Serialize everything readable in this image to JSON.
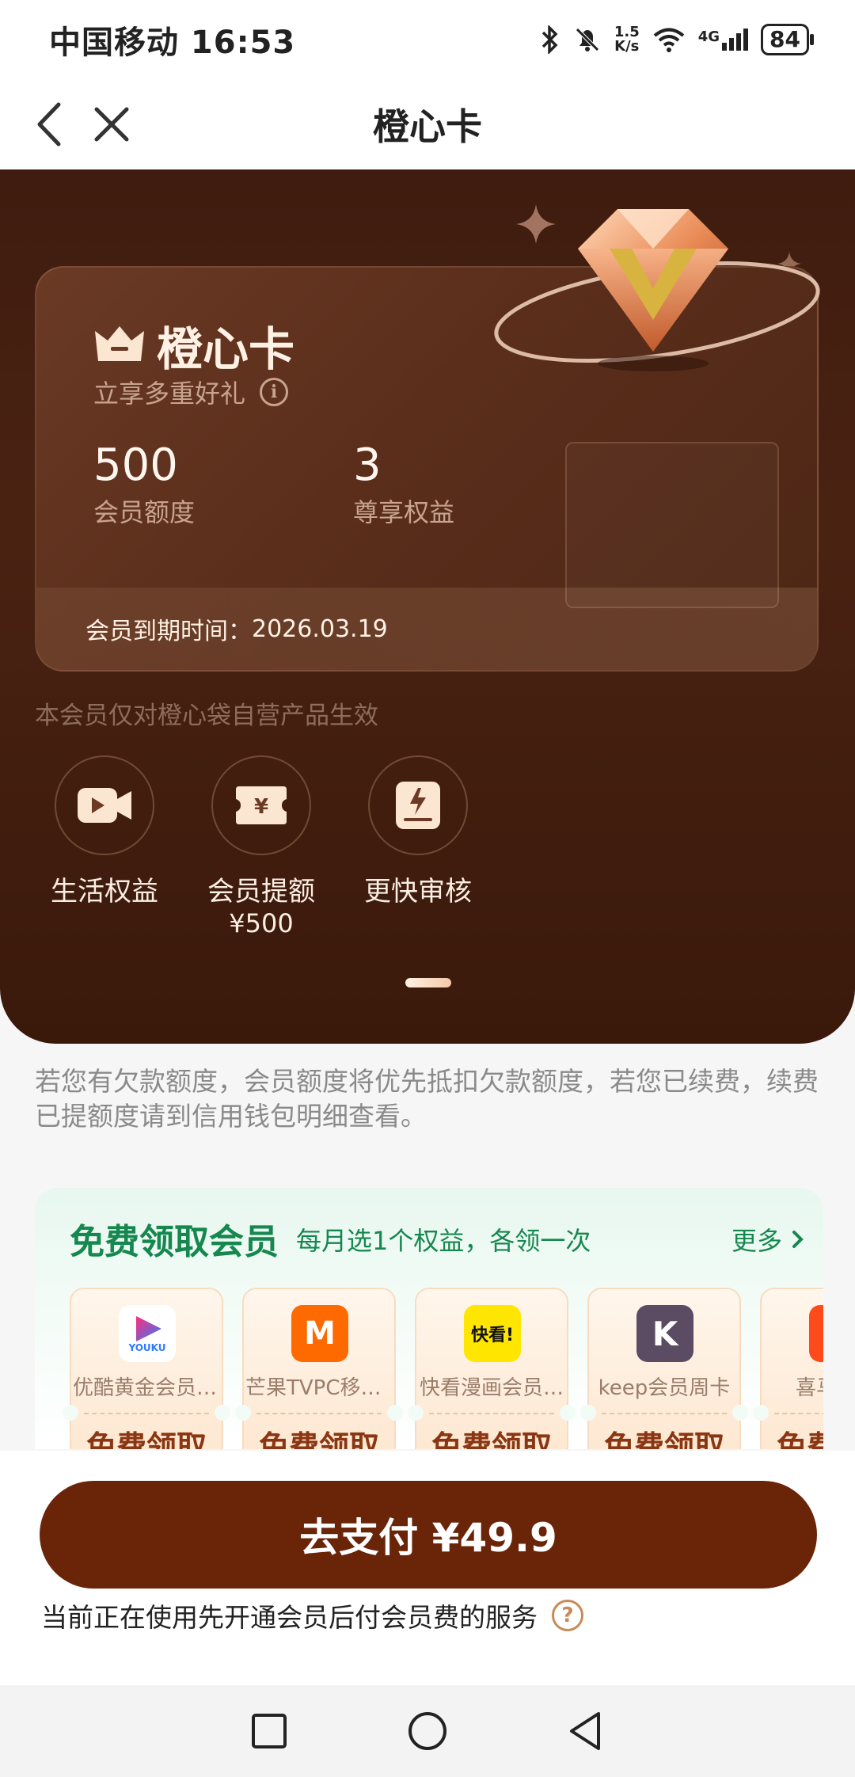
{
  "status_bar": {
    "carrier_time": "中国移动 16:53",
    "net_speed_top": "1.5",
    "net_speed_bottom": "K/s",
    "signal": "4G",
    "battery": "84"
  },
  "nav": {
    "title": "橙心卡",
    "back_icon": "chevron-left-icon",
    "close_icon": "close-icon"
  },
  "card": {
    "title": "橙心卡",
    "subtitle": "立享多重好礼",
    "stats": [
      {
        "value": "500",
        "label": "会员额度"
      },
      {
        "value": "3",
        "label": "尊享权益"
      }
    ],
    "expiry_label": "会员到期时间：",
    "expiry_date": "2026.03.19"
  },
  "hero_note": "本会员仅对橙心袋自营产品生效",
  "benefits": [
    {
      "label": "生活权益",
      "sub": "",
      "icon": "video-icon"
    },
    {
      "label": "会员提额",
      "sub": "¥500",
      "icon": "ticket-icon"
    },
    {
      "label": "更快审核",
      "sub": "",
      "icon": "document-icon"
    }
  ],
  "notice": "若您有欠款额度，会员额度将优先抵扣欠款额度，若您已续费，续费已提额度请到信用钱包明细查看。",
  "free_section": {
    "title": "免费领取会员",
    "subtitle": "每月选1个权益，各领一次",
    "more": "更多",
    "claim_label": "免费领取",
    "items": [
      {
        "name": "优酷黄金会员-…",
        "logo_text": "YOUKU",
        "logo_color": "#ffffff"
      },
      {
        "name": "芒果TVPC移动…",
        "logo_text": "M",
        "logo_color": "#ff6a00"
      },
      {
        "name": "快看漫画会员…",
        "logo_text": "快看!",
        "logo_color": "#ffe600"
      },
      {
        "name": "keep会员周卡",
        "logo_text": "K",
        "logo_color": "#5b4b63"
      },
      {
        "name": "喜马拉雅",
        "logo_text": "",
        "logo_color": "#ff4a1c"
      }
    ]
  },
  "pay": {
    "button_label": "去支付 ¥49.9",
    "note": "当前正在使用先开通会员后付会员费的服务"
  },
  "colors": {
    "hero_bg": "#3f1c0f",
    "pay_button": "#6a2509",
    "green_accent": "#15874f"
  }
}
